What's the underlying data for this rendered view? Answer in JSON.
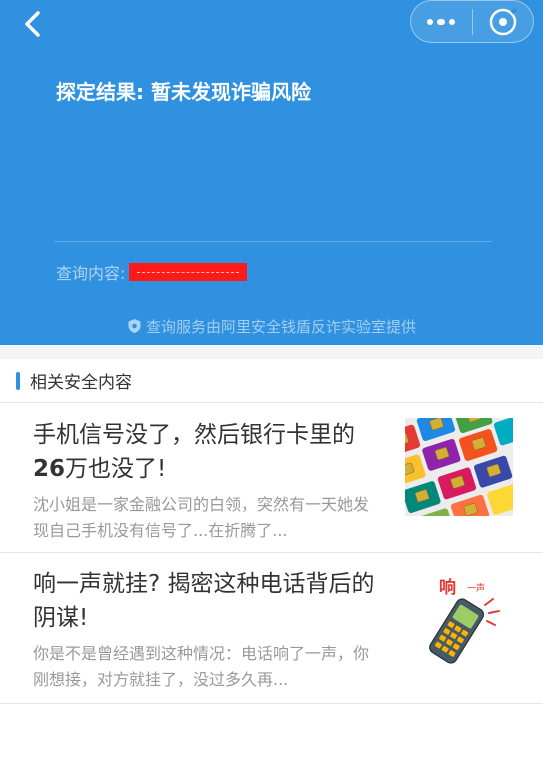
{
  "header": {
    "result_title": "探定结果: 暂未发现诈骗风险",
    "query_label": "查询内容:",
    "provider_text": "查询服务由阿里安全钱盾反诈实验室提供",
    "bg_color": "#2f91e0"
  },
  "capsule": {
    "more_icon": "more-dots-icon",
    "close_icon": "close-target-icon"
  },
  "section": {
    "title": "相关安全内容"
  },
  "articles": [
    {
      "title_part1": "手机信号没了，然后银行卡里的",
      "title_bold": "26",
      "title_part2": "万也没了!",
      "summary": "沈小姐是一家金融公司的白领，突然有一天她发现自己手机没有信号了...在折腾了...",
      "thumb_icon": "sim-cards-image"
    },
    {
      "title": "响一声就挂? 揭密这种电话背后的阴谋!",
      "summary": "你是不是曾经遇到这种情况：电话响了一声，你刚想接，对方就挂了，没过多久再...",
      "thumb_icon": "ringing-phone-image",
      "thumb_caption_main": "响",
      "thumb_caption_small": "一声"
    }
  ]
}
